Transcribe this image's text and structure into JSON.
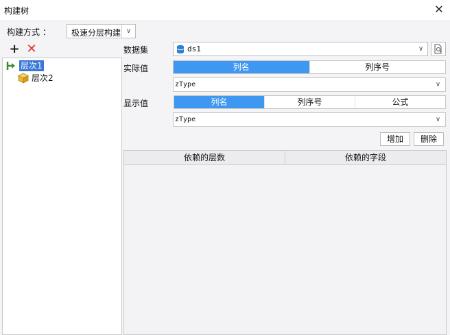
{
  "window": {
    "title": "构建树",
    "close_glyph": "✕"
  },
  "build_mode": {
    "label": "构建方式 ：",
    "value": "极速分层构建"
  },
  "toolbar": {
    "add_glyph": "+",
    "delete_glyph": "✕"
  },
  "tree": {
    "items": [
      {
        "label": "层次1",
        "selected": true,
        "icon": "level-arrow-icon"
      },
      {
        "label": "层次2",
        "selected": false,
        "icon": "cube-icon"
      }
    ]
  },
  "dataset": {
    "label": "数据集",
    "value": "ds1",
    "icon": "database-icon"
  },
  "actual_value": {
    "label": "实际值",
    "tabs": [
      {
        "label": "列名",
        "active": true
      },
      {
        "label": "列序号",
        "active": false
      }
    ],
    "field_value": "zType"
  },
  "display_value": {
    "label": "显示值",
    "tabs": [
      {
        "label": "列名",
        "active": true
      },
      {
        "label": "列序号",
        "active": false
      },
      {
        "label": "公式",
        "active": false
      }
    ],
    "field_value": "zType"
  },
  "buttons": {
    "add": "增加",
    "delete": "删除"
  },
  "dependency_table": {
    "columns": [
      "依赖的层数",
      "依赖的字段"
    ],
    "rows": []
  },
  "colors": {
    "accent": "#3e97f0",
    "selection": "#3b78d6",
    "delete_red": "#e03030"
  }
}
